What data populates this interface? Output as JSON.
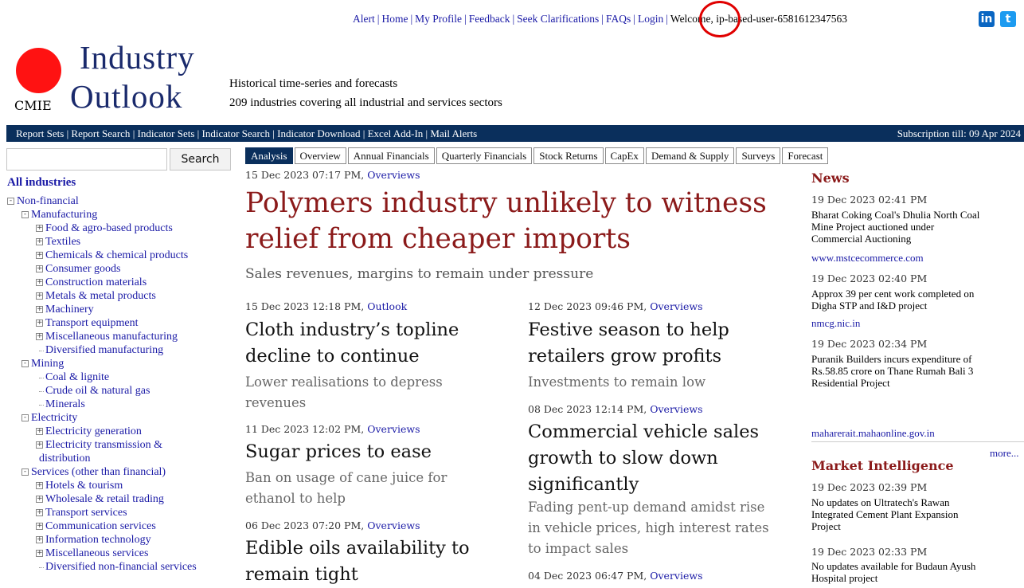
{
  "top": {
    "links": [
      "Alert",
      "Home",
      "My Profile",
      "Feedback",
      "Seek Clarifications",
      "FAQs",
      "Login"
    ],
    "welcome": "Welcome, ip-based-user-6581612347563",
    "linkedin_icon": "in",
    "twitter_icon": "t"
  },
  "logo": {
    "industry": "Industry",
    "outlook": "Outlook",
    "cmie": "CMIE"
  },
  "tagline": [
    "Historical time-series and forecasts",
    "209 industries covering all industrial and services sectors"
  ],
  "nav": {
    "items": [
      "Report Sets",
      "Report Search",
      "Indicator Sets",
      "Indicator Search",
      "Indicator Download",
      "Excel Add-In",
      "Mail Alerts"
    ],
    "subscription": "Subscription till: 09 Apr 2024"
  },
  "search": {
    "button": "Search",
    "placeholder": ""
  },
  "sidebar": {
    "all": "All industries",
    "tree": [
      {
        "label": "Non-financial",
        "depth": 0,
        "exp": "-"
      },
      {
        "label": "Manufacturing",
        "depth": 1,
        "exp": "-"
      },
      {
        "label": "Food & agro-based products",
        "depth": 2,
        "exp": "+"
      },
      {
        "label": "Textiles",
        "depth": 2,
        "exp": "+"
      },
      {
        "label": "Chemicals & chemical products",
        "depth": 2,
        "exp": "+"
      },
      {
        "label": "Consumer goods",
        "depth": 2,
        "exp": "+"
      },
      {
        "label": "Construction materials",
        "depth": 2,
        "exp": "+"
      },
      {
        "label": "Metals & metal products",
        "depth": 2,
        "exp": "+"
      },
      {
        "label": "Machinery",
        "depth": 2,
        "exp": "+"
      },
      {
        "label": "Transport equipment",
        "depth": 2,
        "exp": "+"
      },
      {
        "label": "Miscellaneous manufacturing",
        "depth": 2,
        "exp": "+"
      },
      {
        "label": "Diversified manufacturing",
        "depth": 2,
        "exp": ""
      },
      {
        "label": "Mining",
        "depth": 1,
        "exp": "-"
      },
      {
        "label": "Coal & lignite",
        "depth": 2,
        "exp": ""
      },
      {
        "label": "Crude oil & natural gas",
        "depth": 2,
        "exp": ""
      },
      {
        "label": "Minerals",
        "depth": 2,
        "exp": ""
      },
      {
        "label": "Electricity",
        "depth": 1,
        "exp": "-"
      },
      {
        "label": "Electricity generation",
        "depth": 2,
        "exp": "+"
      },
      {
        "label": "Electricity transmission &",
        "depth": 2,
        "exp": "+"
      },
      {
        "label": "distribution",
        "depth": 3,
        "exp": ""
      },
      {
        "label": "Services (other than financial)",
        "depth": 1,
        "exp": "-"
      },
      {
        "label": "Hotels & tourism",
        "depth": 2,
        "exp": "+"
      },
      {
        "label": "Wholesale & retail trading",
        "depth": 2,
        "exp": "+"
      },
      {
        "label": "Transport services",
        "depth": 2,
        "exp": "+"
      },
      {
        "label": "Communication services",
        "depth": 2,
        "exp": "+"
      },
      {
        "label": "Information technology",
        "depth": 2,
        "exp": "+"
      },
      {
        "label": "Miscellaneous services",
        "depth": 2,
        "exp": "+"
      },
      {
        "label": "Diversified non-financial services",
        "depth": 2,
        "exp": ""
      }
    ]
  },
  "tabs": [
    "Analysis",
    "Overview",
    "Annual Financials",
    "Quarterly Financials",
    "Stock Returns",
    "CapEx",
    "Demand & Supply",
    "Surveys",
    "Forecast"
  ],
  "lead": {
    "date": "15 Dec 2023 07:17 PM,",
    "cat": "Overviews",
    "line1": "Polymers industry unlikely to witness",
    "line2": "relief from cheaper imports",
    "sub": "Sales revenues, margins to remain under pressure"
  },
  "articles": [
    {
      "date": "15 Dec 2023 12:18 PM,",
      "cat": "Outlook",
      "l1": "Cloth industry’s topline",
      "l2": "decline to continue",
      "s1": "Lower realisations to depress",
      "s2": "revenues"
    },
    {
      "date": "11 Dec 2023 12:02 PM,",
      "cat": "Overviews",
      "l1": "Sugar prices to ease",
      "s1": "Ban on usage of cane juice for",
      "s2": "ethanol to help"
    },
    {
      "date": "06 Dec 2023 07:20 PM,",
      "cat": "Overviews",
      "l1": "Edible oils availability to",
      "l2": "remain tight"
    },
    {
      "date": "12 Dec 2023 09:46 PM,",
      "cat": "Overviews",
      "l1": "Festive season to help",
      "l2": "retailers grow profits",
      "s1": "Investments to remain low"
    },
    {
      "date": "08 Dec 2023 12:14 PM,",
      "cat": "Overviews",
      "l1": "Commercial vehicle sales",
      "l2": "growth to slow down",
      "l3": "significantly",
      "s1": "Fading pent-up demand amidst rise",
      "s2": "in vehicle prices, high interest rates",
      "s3": "to impact sales"
    },
    {
      "date": "04 Dec 2023 06:47 PM,",
      "cat": "Overviews"
    }
  ],
  "news": {
    "title": "News",
    "items": [
      {
        "date": "19 Dec 2023 02:41 PM",
        "t1": "Bharat Coking Coal's Dhulia North Coal",
        "t2": "Mine Project auctioned under",
        "t3": "Commercial Auctioning",
        "link": "www.mstcecommerce.com"
      },
      {
        "date": "19 Dec 2023 02:40 PM",
        "t1": "Approx 39 per cent work completed on",
        "t2": "Digha STP and I&D project",
        "link": "nmcg.nic.in"
      },
      {
        "date": "19 Dec 2023 02:34 PM",
        "t1": "Puranik Builders incurs expenditure of",
        "t2": "Rs.58.85 crore on Thane Rumah Bali 3",
        "t3": "Residential Project",
        "link": "maharerait.mahaonline.gov.in"
      }
    ],
    "more": "more..."
  },
  "mi": {
    "title": "Market Intelligence",
    "items": [
      {
        "date": "19 Dec 2023 02:39 PM",
        "t1": "No updates on Ultratech's Rawan",
        "t2": "Integrated Cement Plant Expansion",
        "t3": "Project"
      },
      {
        "date": "19 Dec 2023 02:33 PM",
        "t1": "No updates available for Budaun Ayush",
        "t2": "Hospital project"
      }
    ]
  },
  "colors": {
    "navbar": "#0a2f5c",
    "headline": "#8b1a1a",
    "link": "#1a1aa6",
    "logo_dot": "#ff1212",
    "circle": "#e00000"
  }
}
